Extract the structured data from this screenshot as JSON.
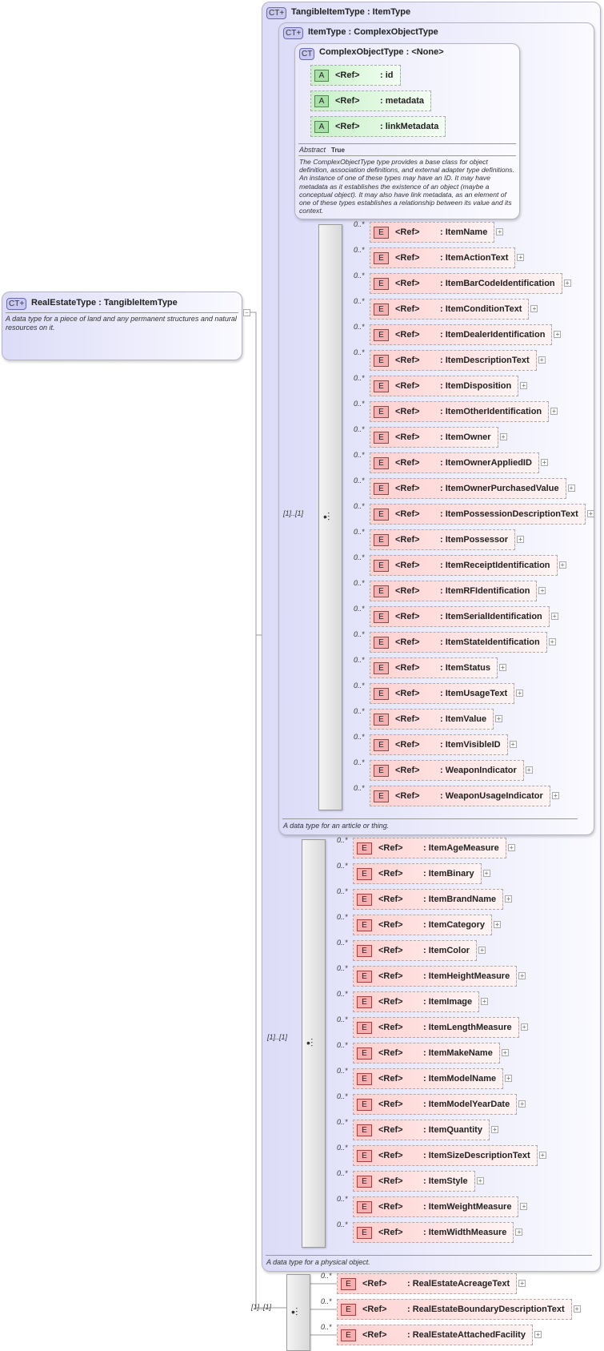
{
  "root": {
    "badge": "CT+",
    "title": "RealEstateType : TangibleItemType",
    "description": "A data type for a piece of land and any permanent structures and natural resources on it."
  },
  "tangible": {
    "badge": "CT+",
    "title": "TangibleItemType : ItemType",
    "description": "A data type for a physical object."
  },
  "itemtype": {
    "badge": "CT+",
    "title": "ItemType : ComplexObjectType",
    "description": "A data type for an article or thing."
  },
  "complex": {
    "badge": "CT",
    "title": "ComplexObjectType : <None>",
    "abstract_label": "Abstract",
    "abstract_value": "True",
    "description": "The ComplexObjectType type provides a base class for object definition, association definitions, and external adapter type definitions. An instance of one of these types may have an ID. It may have metadata as it establishes the existence of an object (maybe a conceptual object). It may also have link metadata, as an element of one of these types establishes a relationship between its value and its context.",
    "attributes": [
      {
        "badge": "A",
        "ref": "<Ref>",
        "name": ": id"
      },
      {
        "badge": "A",
        "ref": "<Ref>",
        "name": ": metadata"
      },
      {
        "badge": "A",
        "ref": "<Ref>",
        "name": ": linkMetadata"
      }
    ]
  },
  "groups": [
    {
      "multiplicity": "[1]..[1]",
      "items": [
        "ItemName",
        "ItemActionText",
        "ItemBarCodeIdentification",
        "ItemConditionText",
        "ItemDealerIdentification",
        "ItemDescriptionText",
        "ItemDisposition",
        "ItemOtherIdentification",
        "ItemOwner",
        "ItemOwnerAppliedID",
        "ItemOwnerPurchasedValue",
        "ItemPossessionDescriptionText",
        "ItemPossessor",
        "ItemReceiptIdentification",
        "ItemRFIdentification",
        "ItemSerialIdentification",
        "ItemStateIdentification",
        "ItemStatus",
        "ItemUsageText",
        "ItemValue",
        "ItemVisibleID",
        "WeaponIndicator",
        "WeaponUsageIndicator"
      ]
    },
    {
      "multiplicity": "[1]..[1]",
      "items": [
        "ItemAgeMeasure",
        "ItemBinary",
        "ItemBrandName",
        "ItemCategory",
        "ItemColor",
        "ItemHeightMeasure",
        "ItemImage",
        "ItemLengthMeasure",
        "ItemMakeName",
        "ItemModelName",
        "ItemModelYearDate",
        "ItemQuantity",
        "ItemSizeDescriptionText",
        "ItemStyle",
        "ItemWeightMeasure",
        "ItemWidthMeasure"
      ]
    },
    {
      "multiplicity": "[1]..[1]",
      "items": [
        "RealEstateAcreageText",
        "RealEstateBoundaryDescriptionText",
        "RealEstateAttachedFacility"
      ]
    }
  ],
  "element_badge": "E",
  "ref_label": "<Ref>",
  "occurrence": "0..*",
  "expand_symbol": "+",
  "collapse_symbol": "−"
}
